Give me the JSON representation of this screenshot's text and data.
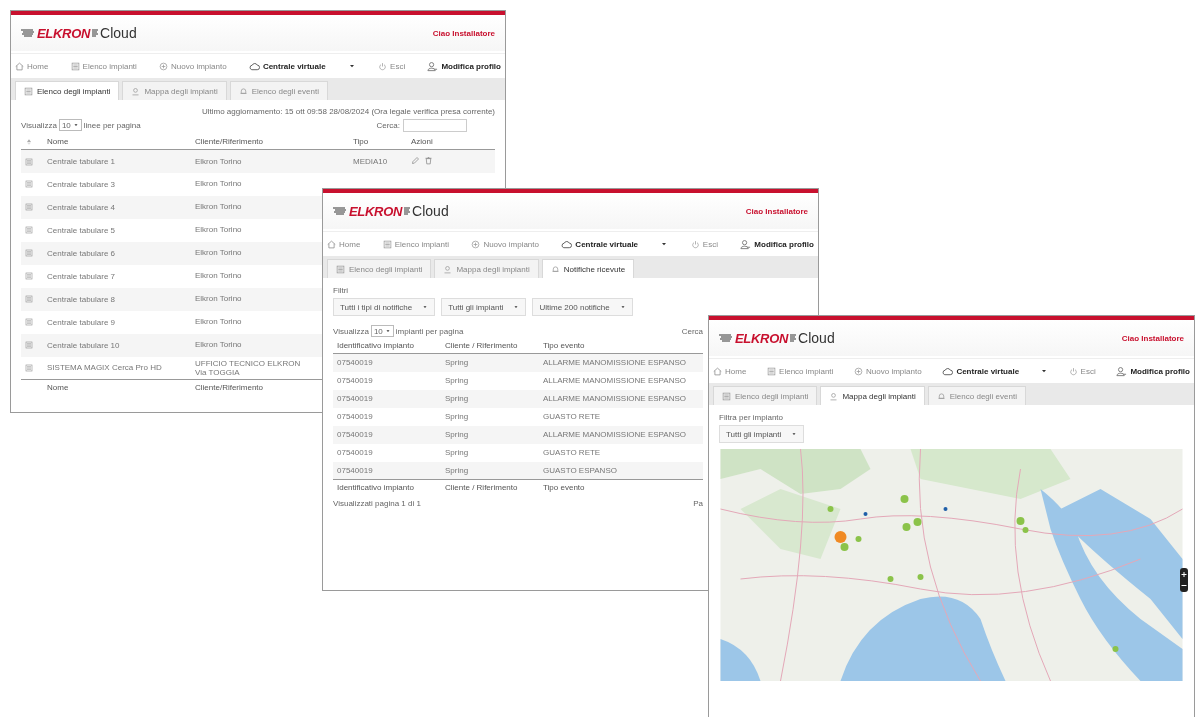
{
  "windows": [
    {
      "kind": "plants",
      "brand": "ELKRON",
      "product": "Cloud",
      "greeting": "Ciao Installatore",
      "nav": [
        {
          "kind": "home",
          "label": "Home",
          "highlighted": false,
          "dropdown": false
        },
        {
          "kind": "list",
          "label": "Elenco impianti",
          "highlighted": false,
          "dropdown": false
        },
        {
          "kind": "add",
          "label": "Nuovo impianto",
          "highlighted": false,
          "dropdown": false
        },
        {
          "kind": "cloud",
          "label": "Centrale virtuale",
          "highlighted": true,
          "dropdown": true
        },
        {
          "kind": "power",
          "label": "Esci",
          "highlighted": false,
          "dropdown": false
        },
        {
          "kind": "user",
          "label": "Modifica profilo",
          "highlighted": true,
          "dropdown": false
        }
      ],
      "tabs": [
        {
          "label": "Elenco degli impianti",
          "selected": true
        },
        {
          "label": "Mappa degli impianti",
          "selected": false
        },
        {
          "label": "Elenco degli eventi",
          "selected": false
        }
      ],
      "note": "Ultimo aggiornamento: 15 ott 09:58 28/08/2024 (Ora legale verifica presa corrente)",
      "length": {
        "before": "Visualizza",
        "value": "10",
        "after": "linee per pagina"
      },
      "search_label": "Cerca:",
      "columns": [
        "Nome",
        "Cliente/Riferimento",
        "Tipo",
        "Azioni"
      ],
      "rows": [
        {
          "name": "Centrale tabulare 1",
          "client": "Elkron Torino",
          "type": "MEDIA10",
          "actions": true
        },
        {
          "name": "Centrale tabulare 3",
          "client": "Elkron Torino"
        },
        {
          "name": "Centrale tabulare 4",
          "client": "Elkron Torino"
        },
        {
          "name": "Centrale tabulare 5",
          "client": "Elkron Torino"
        },
        {
          "name": "Centrale tabulare 6",
          "client": "Elkron Torino"
        },
        {
          "name": "Centrale tabulare 7",
          "client": "Elkron Torino"
        },
        {
          "name": "Centrale tabulare 8",
          "client": "Elkron Torino"
        },
        {
          "name": "Centrale tabulare 9",
          "client": "Elkron Torino"
        },
        {
          "name": "Centrale tabulare 10",
          "client": "Elkron Torino"
        },
        {
          "name": "SISTEMA MAGIX Cerca Pro HD",
          "client": "UFFICIO TECNICO ELKRON Via TOGGIA"
        }
      ],
      "footer_columns": [
        "Nome",
        "Cliente/Riferimento"
      ]
    },
    {
      "kind": "events",
      "brand": "ELKRON",
      "product": "Cloud",
      "greeting": "Ciao Installatore",
      "nav": [
        {
          "kind": "home",
          "label": "Home",
          "highlighted": false,
          "dropdown": false
        },
        {
          "kind": "list",
          "label": "Elenco impianti",
          "highlighted": false,
          "dropdown": false
        },
        {
          "kind": "add",
          "label": "Nuovo impianto",
          "highlighted": false,
          "dropdown": false
        },
        {
          "kind": "cloud",
          "label": "Centrale virtuale",
          "highlighted": true,
          "dropdown": true
        },
        {
          "kind": "power",
          "label": "Esci",
          "highlighted": false,
          "dropdown": false
        },
        {
          "kind": "user",
          "label": "Modifica profilo",
          "highlighted": true,
          "dropdown": false
        }
      ],
      "tabs": [
        {
          "label": "Elenco degli impianti",
          "selected": false
        },
        {
          "label": "Mappa degli impianti",
          "selected": false
        },
        {
          "label": "Notifiche ricevute",
          "selected": true
        }
      ],
      "filter_label": "Filtri",
      "filters": [
        "Tutti i tipi di notifiche",
        "Tutti gli impianti",
        "Ultime 200 notifiche"
      ],
      "length": {
        "before": "Visualizza",
        "value": "10",
        "after": "impianti per pagina"
      },
      "search_label": "Cerca",
      "columns": [
        "Identificativo impianto",
        "Cliente / Riferimento",
        "Tipo evento"
      ],
      "rows": [
        {
          "id": "07540019",
          "client": "Spring",
          "event": "ALLARME MANOMISSIONE ESPANSO"
        },
        {
          "id": "07540019",
          "client": "Spring",
          "event": "ALLARME MANOMISSIONE ESPANSO"
        },
        {
          "id": "07540019",
          "client": "Spring",
          "event": "ALLARME MANOMISSIONE ESPANSO"
        },
        {
          "id": "07540019",
          "client": "Spring",
          "event": "GUASTO RETE"
        },
        {
          "id": "07540019",
          "client": "Spring",
          "event": "ALLARME MANOMISSIONE ESPANSO"
        },
        {
          "id": "07540019",
          "client": "Spring",
          "event": "GUASTO RETE"
        },
        {
          "id": "07540019",
          "client": "Spring",
          "event": "GUASTO ESPANSO"
        }
      ],
      "footer_columns": [
        "Identificativo impianto",
        "Cliente / Riferimento",
        "Tipo evento"
      ],
      "info": "Visualizzati pagina 1 di 1",
      "pager": "Pa"
    },
    {
      "kind": "map",
      "brand": "ELKRON",
      "product": "Cloud",
      "greeting": "Ciao Installatore",
      "nav": [
        {
          "kind": "home",
          "label": "Home",
          "highlighted": false,
          "dropdown": false
        },
        {
          "kind": "list",
          "label": "Elenco impianti",
          "highlighted": false,
          "dropdown": false
        },
        {
          "kind": "add",
          "label": "Nuovo impianto",
          "highlighted": false,
          "dropdown": false
        },
        {
          "kind": "cloud",
          "label": "Centrale virtuale",
          "highlighted": true,
          "dropdown": true
        },
        {
          "kind": "power",
          "label": "Esci",
          "highlighted": false,
          "dropdown": false
        },
        {
          "kind": "user",
          "label": "Modifica profilo",
          "highlighted": true,
          "dropdown": false
        }
      ],
      "tabs": [
        {
          "label": "Elenco degli impianti",
          "selected": false
        },
        {
          "label": "Mappa degli impianti",
          "selected": true
        },
        {
          "label": "Elenco degli eventi",
          "selected": false
        }
      ],
      "filter_label": "Filtra per impianto",
      "filters": [
        "Tutti gli impianti"
      ]
    }
  ]
}
